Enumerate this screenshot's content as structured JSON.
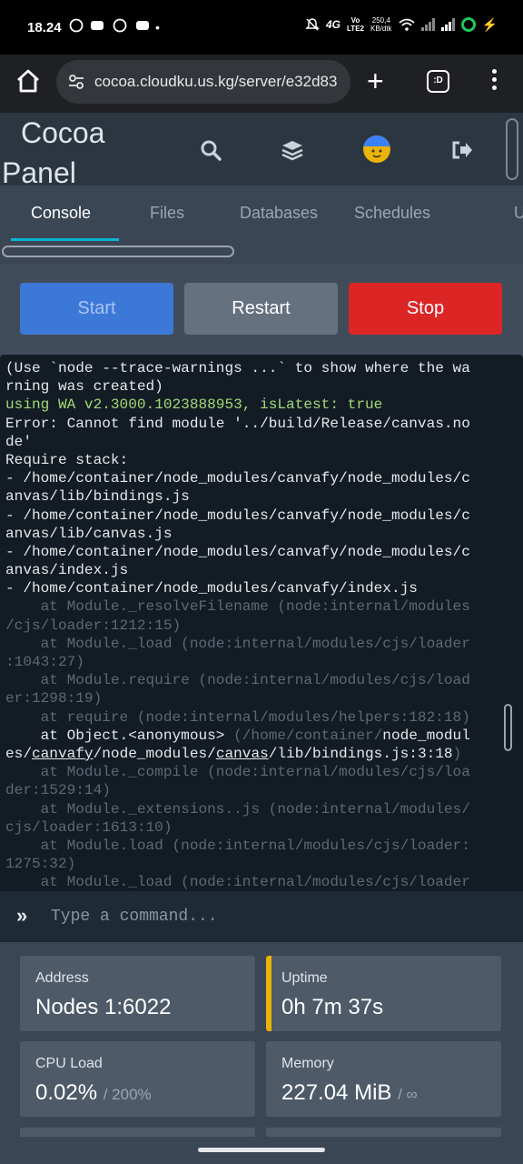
{
  "status_bar": {
    "time": "18.24",
    "network_label_top": "Vo",
    "network_label_bottom": "LTE2",
    "network_type": "4G",
    "speed_value": "250,4",
    "speed_unit": "KB/dtk"
  },
  "browser": {
    "url": "cocoa.cloudku.us.kg/server/e32d83",
    "tabs_label": ":D"
  },
  "header": {
    "brand_line1": "Cocoa",
    "brand_line2": "Panel"
  },
  "nav": {
    "tabs": [
      {
        "label": "Console",
        "active": true
      },
      {
        "label": "Files",
        "active": false
      },
      {
        "label": "Databases",
        "active": false
      },
      {
        "label": "Schedules",
        "active": false
      },
      {
        "label": "U",
        "active": false
      }
    ]
  },
  "power": {
    "start_label": "Start",
    "restart_label": "Restart",
    "stop_label": "Stop"
  },
  "console": {
    "lines": [
      {
        "text": "(Use `node --trace-warnings ...` to show where the wa",
        "style": "normal"
      },
      {
        "text": "rning was created)",
        "style": "normal"
      },
      {
        "text": "using WA v2.3000.1023888953, isLatest: true",
        "style": "green"
      },
      {
        "text": "Error: Cannot find module '../build/Release/canvas.no",
        "style": "normal"
      },
      {
        "text": "de'",
        "style": "normal"
      },
      {
        "text": "Require stack:",
        "style": "normal"
      },
      {
        "text": "- /home/container/node_modules/canvafy/node_modules/c",
        "style": "normal"
      },
      {
        "text": "anvas/lib/bindings.js",
        "style": "normal"
      },
      {
        "text": "- /home/container/node_modules/canvafy/node_modules/c",
        "style": "normal"
      },
      {
        "text": "anvas/lib/canvas.js",
        "style": "normal"
      },
      {
        "text": "- /home/container/node_modules/canvafy/node_modules/c",
        "style": "normal"
      },
      {
        "text": "anvas/index.js",
        "style": "normal"
      },
      {
        "text": "- /home/container/node_modules/canvafy/index.js",
        "style": "normal"
      },
      {
        "text": "    at Module._resolveFilename (node:internal/modules",
        "style": "dim"
      },
      {
        "text": "/cjs/loader:1212:15)",
        "style": "dim"
      },
      {
        "text": "    at Module._load (node:internal/modules/cjs/loader",
        "style": "dim"
      },
      {
        "text": ":1043:27)",
        "style": "dim"
      },
      {
        "text": "    at Module.require (node:internal/modules/cjs/load",
        "style": "dim"
      },
      {
        "text": "er:1298:19)",
        "style": "dim"
      },
      {
        "text": "    at require (node:internal/modules/helpers:182:18)",
        "style": "dim"
      },
      {
        "text": "",
        "style": "mixed1"
      },
      {
        "text": "",
        "style": "mixed2"
      },
      {
        "text": "    at Module._compile (node:internal/modules/cjs/loa",
        "style": "dim"
      },
      {
        "text": "der:1529:14)",
        "style": "dim"
      },
      {
        "text": "    at Module._extensions..js (node:internal/modules/",
        "style": "dim"
      },
      {
        "text": "cjs/loader:1613:10)",
        "style": "dim"
      },
      {
        "text": "    at Module.load (node:internal/modules/cjs/loader:",
        "style": "dim"
      },
      {
        "text": "1275:32)",
        "style": "dim"
      },
      {
        "text": "    at Module._load (node:internal/modules/cjs/loader",
        "style": "dim"
      }
    ],
    "object_line": {
      "p1": "    at Object.<anonymous> ",
      "p2": "(/home/container/",
      "p3": "node_modul"
    },
    "object_line2": {
      "p1": "es/",
      "p2": "canvafy",
      "p3": "/node_modules/",
      "p4": "canvas",
      "p5": "/lib/bindings.js:3:18",
      "p6": ")"
    }
  },
  "command": {
    "placeholder": "Type a command..."
  },
  "stats": {
    "address": {
      "label": "Address",
      "value": "Nodes 1:6022"
    },
    "uptime": {
      "label": "Uptime",
      "value": "0h 7m 37s"
    },
    "cpu": {
      "label": "CPU Load",
      "value": "0.02%",
      "limit": "/ 200%"
    },
    "memory": {
      "label": "Memory",
      "value": "227.04 MiB",
      "limit": "/ ∞"
    }
  },
  "colors": {
    "accent_cyan": "#06b6d4",
    "start_blue": "#3c78d8",
    "stop_red": "#dc2626",
    "uptime_accent": "#eab308",
    "console_bg": "#131c24"
  }
}
